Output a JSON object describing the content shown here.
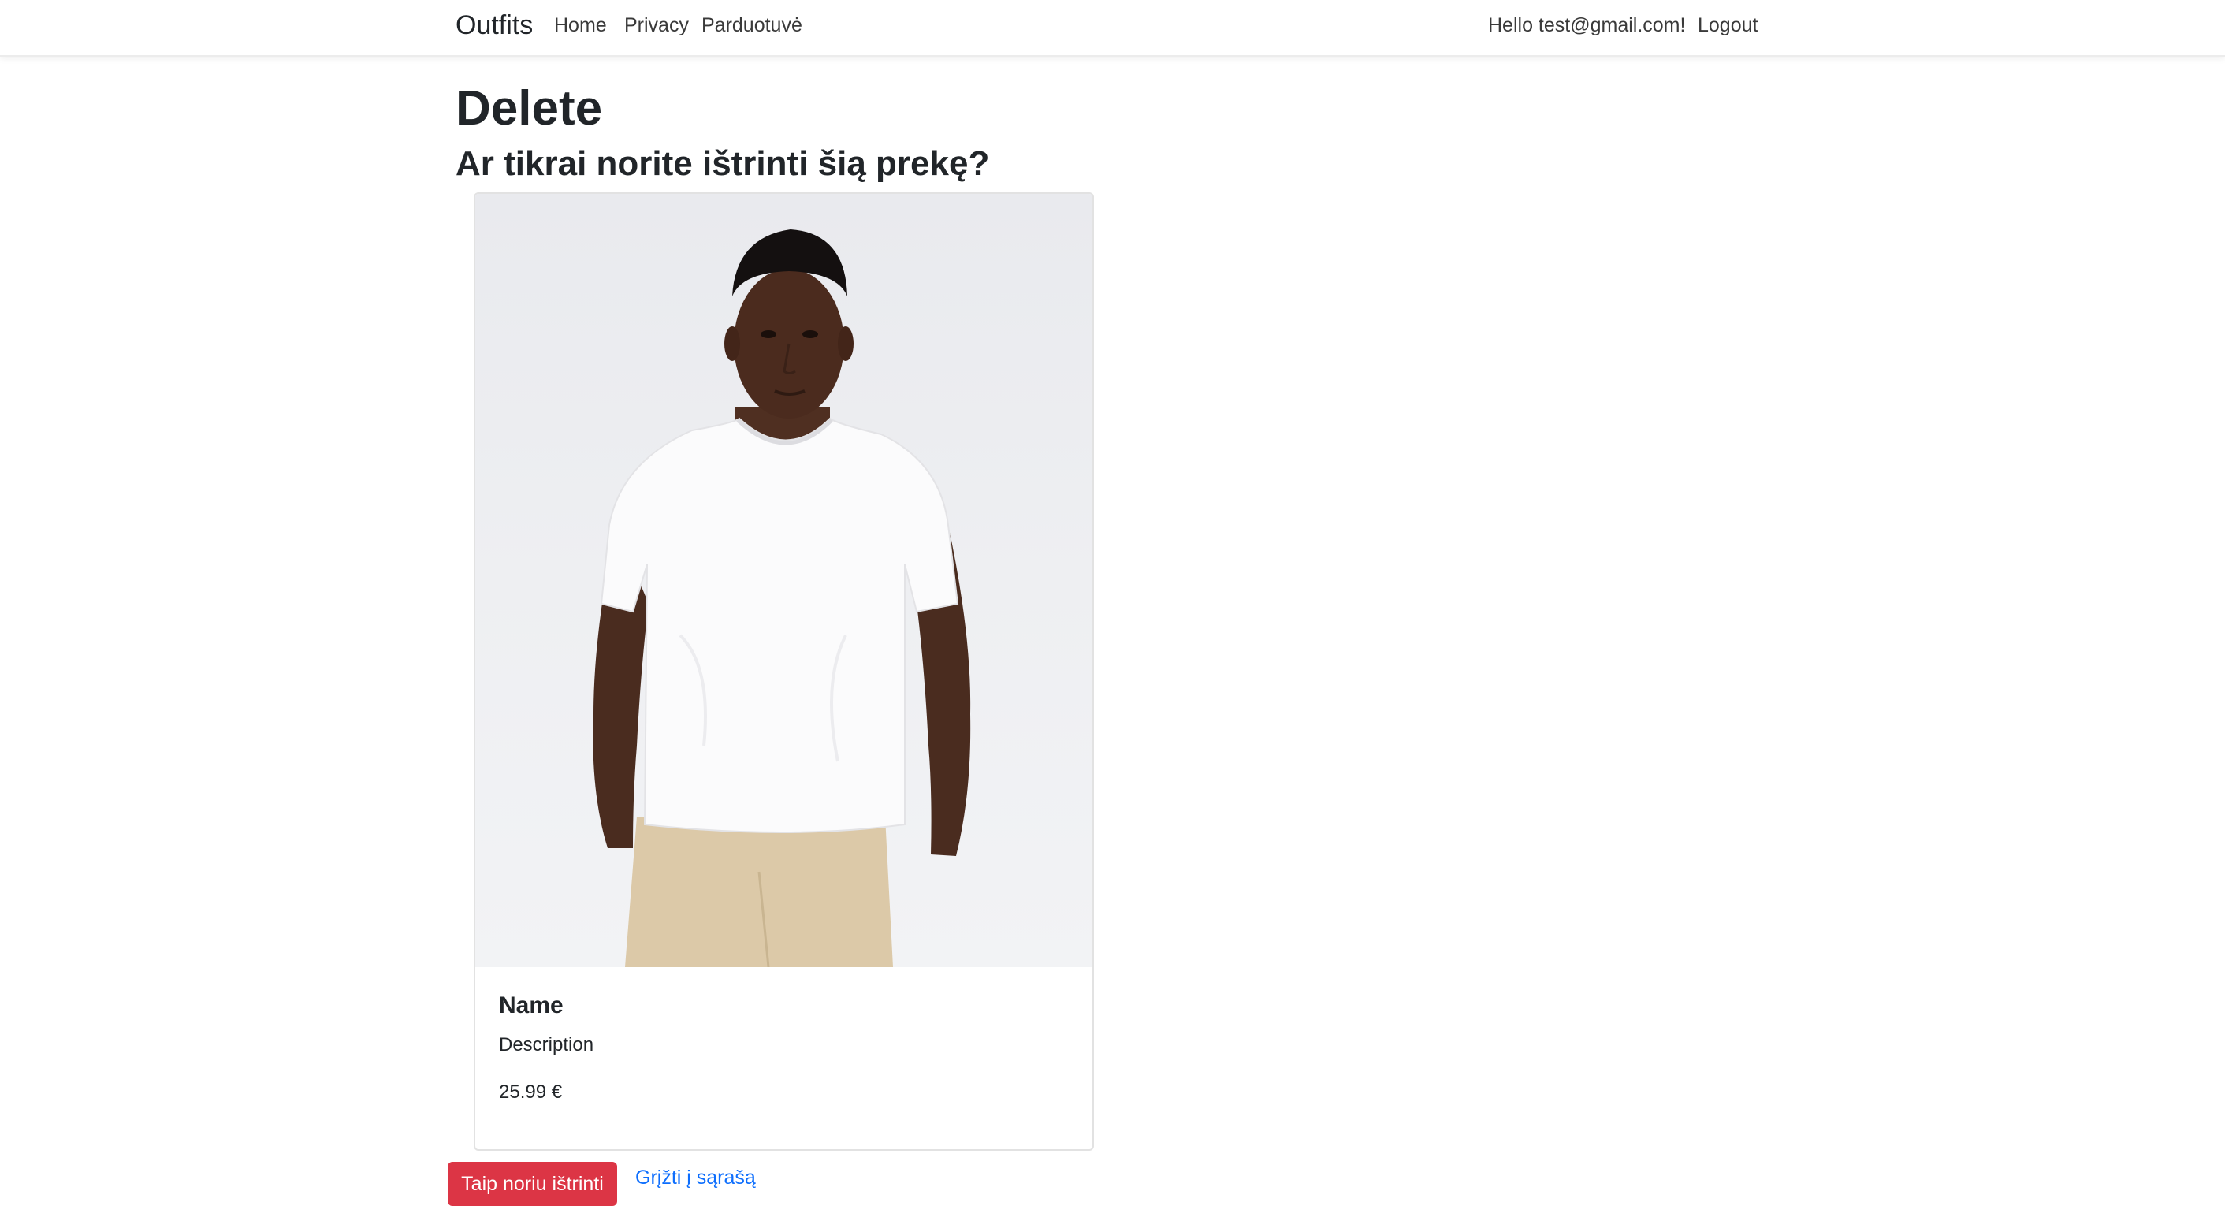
{
  "navbar": {
    "brand": "Outfits",
    "links": [
      {
        "label": "Home"
      },
      {
        "label": "Privacy"
      },
      {
        "label": "Parduotuvė"
      }
    ],
    "greeting": "Hello test@gmail.com!",
    "logout": "Logout"
  },
  "page": {
    "title": "Delete",
    "subtitle": "Ar tikrai norite ištrinti šią prekę?"
  },
  "product": {
    "image_alt": "Man wearing white t-shirt",
    "name": "Name",
    "description": "Description",
    "price": "25.99 €"
  },
  "actions": {
    "delete_label": "Taip noriu ištrinti",
    "back_label": "Grįžti į sąrašą"
  },
  "colors": {
    "danger": "#dc3545",
    "link": "#0d6efd"
  }
}
